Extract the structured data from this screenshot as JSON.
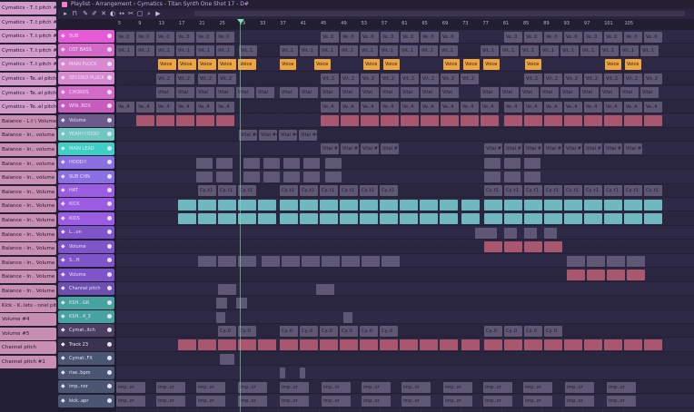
{
  "window": {
    "title": "Playlist - Arrangement › Cymatics - Titan Synth One Shot 17 - D#"
  },
  "colors": {
    "pink": "#e65ad8",
    "lpink": "#d189c9",
    "orange": "#f0a640",
    "gray": "#5e5874",
    "teal": "#4fd3b6",
    "purple": "#9a5ce0",
    "mauve": "#a9576f",
    "lightteal": "#6fb8c0",
    "cyan": "#3cd0c6"
  },
  "left_panel": [
    "Cymatics - T..t pitch #32",
    "Cymatics - T..t pitch #29",
    "Cymatics - T..t pitch #34",
    "Cymatics - T..t pitch #30",
    "Cymatics - T..t pitch #31",
    "Cymatics - Te..el pitch #3",
    "Cymatics - Te..el pitch #1",
    "Cymatics - Te..el pitch #7",
    "Balance - L.t \\ Volume",
    "Balance - In.. volume #19",
    "Balance - In.. volume #14",
    "Balance - In.. volume #10",
    "Balance - In.. volume #11",
    "Balance - In.. Volume #5",
    "Balance - In.. Volume #1",
    "Balance - In.. Volume #6",
    "Balance - In.. Volume #2",
    "Balance - In.. Volume #4",
    "Balance - In.. Volume #5",
    "Balance - In.. Volume #3",
    "Balance - In.. Volume #7",
    "Kick - K..lets - nnel pitch",
    "Volume #4",
    "Volume #5",
    "Channel pitch",
    "Channel pitch #1"
  ],
  "tracks": [
    {
      "name": "SUB",
      "color": "#e65ad8"
    },
    {
      "name": "DST BASS",
      "color": "#d36ac7"
    },
    {
      "name": "MAIN PLUCK",
      "color": "#d889cf"
    },
    {
      "name": "SECOND PLUCK",
      "color": "#d889cf"
    },
    {
      "name": "CHORDS",
      "color": "#d36ac7"
    },
    {
      "name": "WIN..RDS",
      "color": "#c65cbc"
    },
    {
      "name": "Volume",
      "color": "#6c5a8a"
    },
    {
      "name": "YEAH!!!!OOO",
      "color": "#6fc7c2"
    },
    {
      "name": "MAIN LEAD",
      "color": "#3cd0c6"
    },
    {
      "name": "HOOD!!",
      "color": "#8a6fe0"
    },
    {
      "name": "SUB CHN",
      "color": "#8a6fe0"
    },
    {
      "name": "HAT",
      "color": "#9a5ce0"
    },
    {
      "name": "KICK",
      "color": "#9a5ce0"
    },
    {
      "name": "KIDS",
      "color": "#9a5ce0"
    },
    {
      "name": "L...on",
      "color": "#7e54c8"
    },
    {
      "name": "Volume",
      "color": "#7e54c8"
    },
    {
      "name": "S...ft",
      "color": "#7e54c8"
    },
    {
      "name": "Volume",
      "color": "#7e54c8"
    },
    {
      "name": "Channel pitch",
      "color": "#6d4fb0"
    },
    {
      "name": "KSH...GR",
      "color": "#46a3a0"
    },
    {
      "name": "KSH...4_3",
      "color": "#46a3a0"
    },
    {
      "name": "Cymat..itch",
      "color": "#4b3f62"
    },
    {
      "name": "Track 23",
      "color": "#3a3350"
    },
    {
      "name": "Cymat..FX",
      "color": "#4b5672"
    },
    {
      "name": "rise..bpm",
      "color": "#4b5672"
    },
    {
      "name": "imp..nor",
      "color": "#4b5672"
    },
    {
      "name": "kick..apr",
      "color": "#4b5672"
    }
  ],
  "ruler_ticks": [
    "5",
    "9",
    "13",
    "17",
    "21",
    "25",
    "29",
    "33",
    "37",
    "41",
    "45",
    "49",
    "53",
    "57",
    "61",
    "65",
    "69",
    "73",
    "77",
    "81",
    "85",
    "89",
    "93",
    "97",
    "101",
    "105"
  ],
  "clip_labels": {
    "sub": "Ve..0",
    "dst": "Vit..1",
    "pluck": "Voice",
    "second": "Vit..2",
    "chords": "Vital",
    "winrds": "Ve..4",
    "yeah": "Vital #4",
    "lead": "Vital #7",
    "hat": "Cy..t1",
    "imp": "imp..or",
    "cym": "Cy..0"
  }
}
